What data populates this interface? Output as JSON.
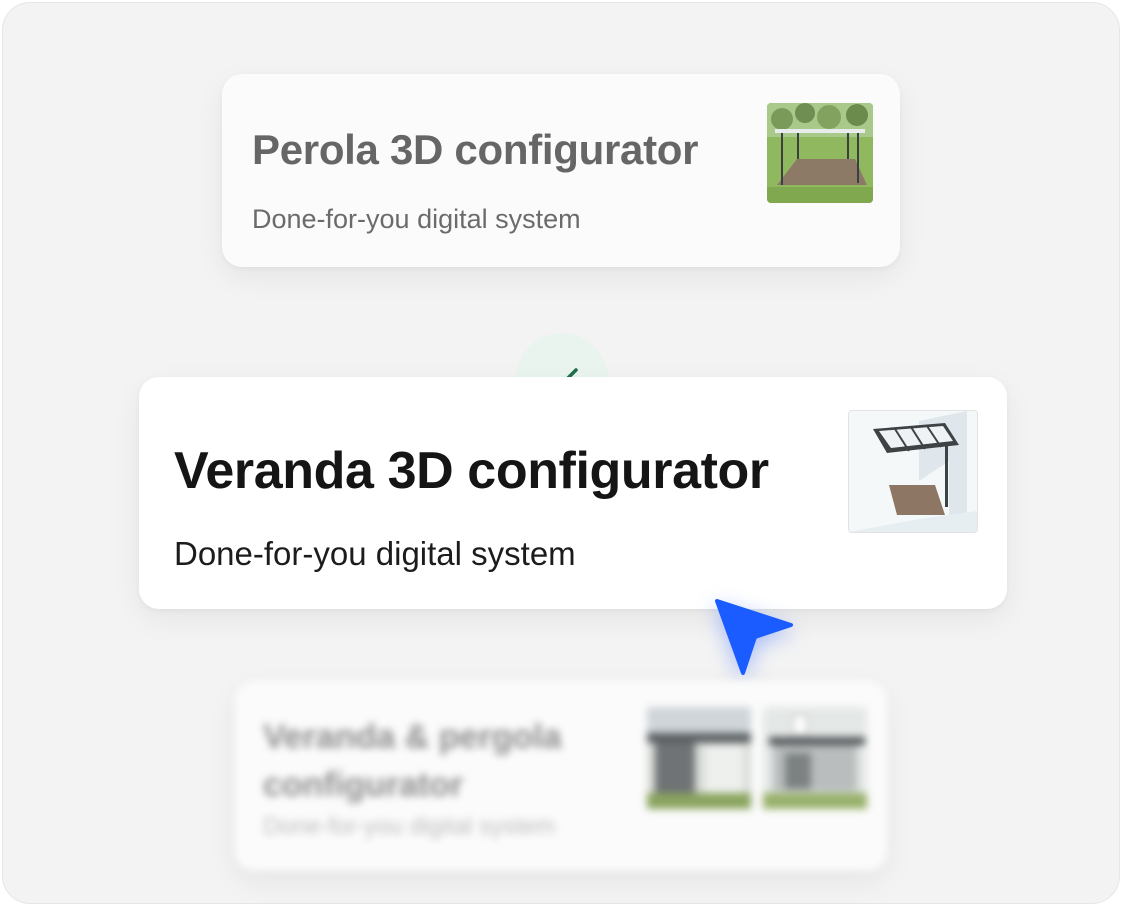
{
  "cards": {
    "top": {
      "title": "Perola 3D configurator",
      "subtitle": "Done-for-you digital system",
      "thumbnail_icon": "pergola-garden-image"
    },
    "main": {
      "title": "Veranda 3D configurator",
      "subtitle": "Done-for-you digital system",
      "thumbnail_icon": "veranda-model-image",
      "selected": true
    },
    "bottom": {
      "title": "Veranda & pergola configurator",
      "subtitle": "Done-for-you digital system",
      "thumbnail_icons": [
        "veranda-house-image",
        "pergola-house-image"
      ]
    }
  },
  "badge": {
    "icon": "checkmark-icon",
    "color": "#1f6e4b",
    "background": "#e9f4ee"
  },
  "cursor": {
    "icon": "pointer-cursor-icon",
    "color": "#1a5cff"
  }
}
